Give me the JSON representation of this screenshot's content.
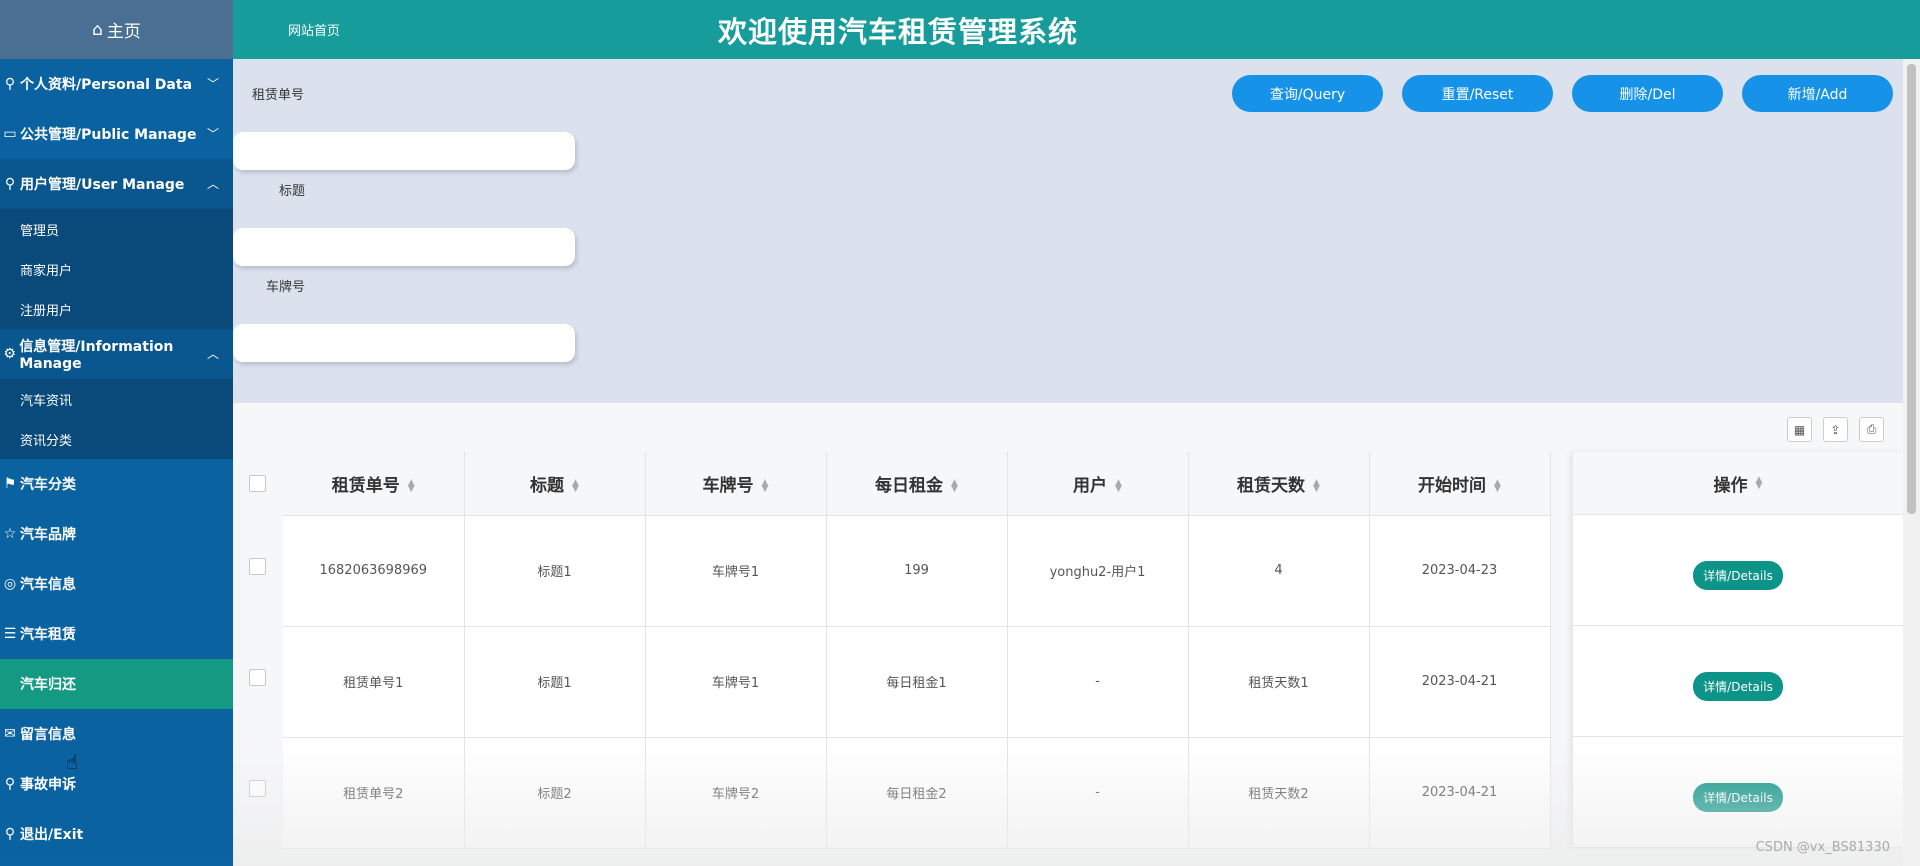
{
  "sidebar": {
    "home_label": "主页",
    "menus": [
      {
        "label": "个人资料/Personal Data",
        "chevron": "down"
      },
      {
        "label": "公共管理/Public Manage",
        "chevron": "down"
      },
      {
        "label": "用户管理/User Manage",
        "chevron": "up"
      }
    ],
    "user_sub": [
      "管理员",
      "商家用户",
      "注册用户"
    ],
    "info_menu": "信息管理/Information Manage",
    "info_sub": [
      "汽车资讯",
      "资讯分类"
    ],
    "plain_menus": [
      "汽车分类",
      "汽车品牌",
      "汽车信息",
      "汽车租赁"
    ],
    "active_menu": "汽车归还",
    "tail_menus": [
      "留言信息",
      "事故申诉",
      "退出/Exit"
    ]
  },
  "header": {
    "site_link": "网站首页",
    "title": "欢迎使用汽车租赁管理系统"
  },
  "search": {
    "labels": [
      "租赁单号",
      "标题",
      "车牌号"
    ],
    "buttons": {
      "query": "查询/Query",
      "reset": "重置/Reset",
      "delete": "删除/Del",
      "add": "新增/Add"
    }
  },
  "table": {
    "headers": [
      "租赁单号",
      "标题",
      "车牌号",
      "每日租金",
      "用户",
      "租赁天数",
      "开始时间"
    ],
    "ops_header": "操作",
    "detail_label": "详情/Details",
    "rows": [
      [
        "1682063698969",
        "标题1",
        "车牌号1",
        "199",
        "yonghu2-用户1",
        "4",
        "2023-04-23"
      ],
      [
        "租赁单号1",
        "标题1",
        "车牌号1",
        "每日租金1",
        "-",
        "租赁天数1",
        "2023-04-21"
      ],
      [
        "租赁单号2",
        "标题2",
        "车牌号2",
        "每日租金2",
        "-",
        "租赁天数2",
        "2023-04-21"
      ]
    ]
  },
  "watermark": "CSDN @vx_BS81330"
}
